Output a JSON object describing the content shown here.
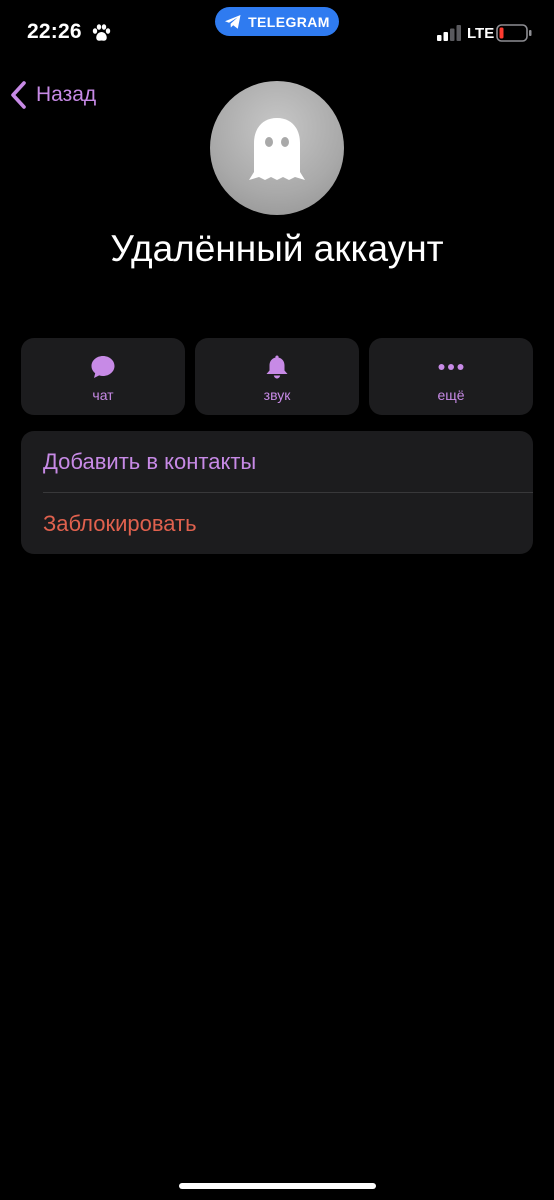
{
  "status_bar": {
    "time": "22:26",
    "app_pill_label": "TELEGRAM",
    "network": "LTE",
    "app_pill_color": "#2f7bf0",
    "battery_level_color": "#ff3b30"
  },
  "nav": {
    "back_label": "Назад"
  },
  "profile": {
    "name": "Удалённый аккаунт",
    "avatar_icon": "ghost-icon"
  },
  "actions": [
    {
      "label": "чат",
      "icon": "chat-bubble-icon"
    },
    {
      "label": "звук",
      "icon": "bell-icon"
    },
    {
      "label": "ещё",
      "icon": "more-dots-icon"
    }
  ],
  "options": {
    "add_contact": "Добавить в контакты",
    "block": "Заблокировать"
  },
  "colors": {
    "accent": "#c78ae6",
    "destructive": "#e0614e",
    "card_background": "#1c1c1e",
    "background": "#000000"
  }
}
